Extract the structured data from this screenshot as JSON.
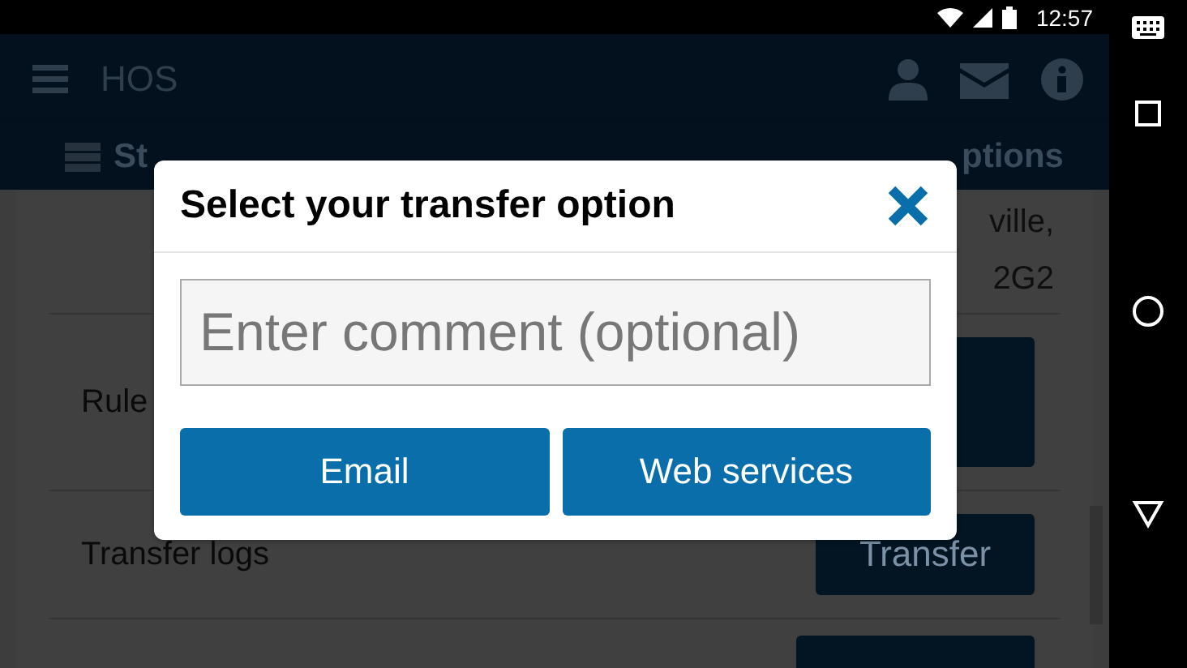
{
  "status_bar": {
    "time": "12:57"
  },
  "app_bar": {
    "title": "HOS"
  },
  "tabs": [
    {
      "label": "St"
    },
    {
      "label": "ptions"
    }
  ],
  "content": {
    "address_lines": [
      "ville,",
      "2G2"
    ],
    "rows": [
      {
        "label": "Rule"
      },
      {
        "label": "Transfer logs",
        "button": "Transfer"
      }
    ]
  },
  "dialog": {
    "title": "Select your transfer option",
    "comment": {
      "placeholder": "Enter comment (optional)"
    },
    "buttons": [
      "Email",
      "Web services"
    ]
  }
}
